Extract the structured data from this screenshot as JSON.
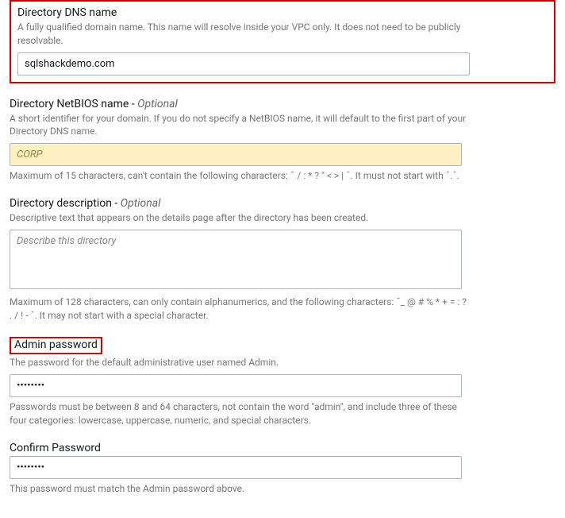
{
  "dns": {
    "label": "Directory DNS name",
    "helper": "A fully qualified domain name. This name will resolve inside your VPC only. It does not need to be publicly resolvable.",
    "value": "sqlshackdemo.com"
  },
  "netbios": {
    "label": "Directory NetBIOS name - ",
    "optional": "Optional",
    "helper": "A short identifier for your domain. If you do not specify a NetBIOS name, it will default to the first part of your Directory DNS name.",
    "value": "CORP",
    "hint": "Maximum of 15 characters, can't contain the following characters: ˆ / : * ? \" < > | ˇ. It must not start with ˇ.ˇ."
  },
  "description": {
    "label": "Directory description - ",
    "optional": "Optional",
    "helper": "Descriptive text that appears on the details page after the directory has been created.",
    "placeholder": "Describe this directory",
    "hint": "Maximum of 128 characters, can only contain alphanumerics, and the following characters: ˇ_ @ # % * + = : ? . / ! - ˇ. It may not start with a special character."
  },
  "password": {
    "label": "Admin password",
    "helper": "The password for the default administrative user named Admin.",
    "value": "••••••••",
    "hint": "Passwords must be between 8 and 64 characters, not contain the word \"admin\", and include three of these four categories: lowercase, uppercase, numeric, and special characters."
  },
  "confirm": {
    "label": "Confirm Password",
    "value": "••••••••",
    "hint": "This password must match the Admin password above."
  }
}
